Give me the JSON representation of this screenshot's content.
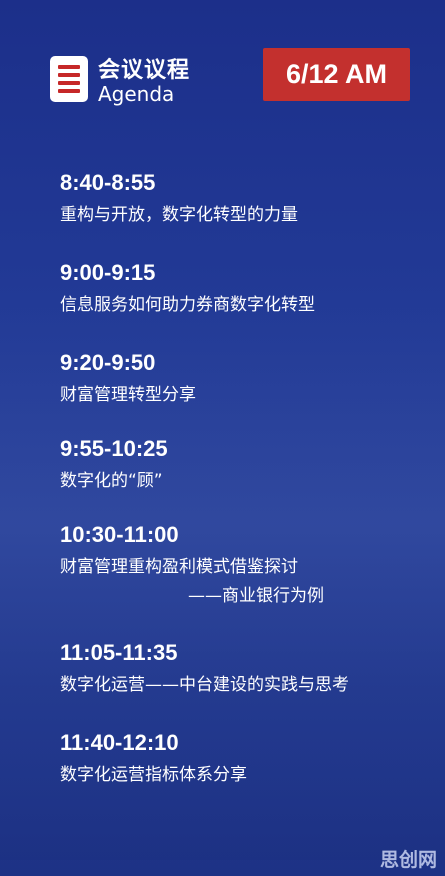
{
  "header": {
    "title_zh": "会议议程",
    "title_en": "Agenda",
    "time_badge": "6/12 AM"
  },
  "agenda": [
    {
      "time": "8:40-8:55",
      "topic": "重构与开放，数字化转型的力量",
      "sub": ""
    },
    {
      "time": "9:00-9:15",
      "topic": "信息服务如何助力券商数字化转型",
      "sub": ""
    },
    {
      "time": "9:20-9:50",
      "topic": "财富管理转型分享",
      "sub": ""
    },
    {
      "time": "9:55-10:25",
      "topic": "数字化的“顾”",
      "sub": ""
    },
    {
      "time": "10:30-11:00",
      "topic": "财富管理重构盈利模式借鉴探讨",
      "sub": "——商业银行为例"
    },
    {
      "time": "11:05-11:35",
      "topic": "数字化运营——中台建设的实践与思考",
      "sub": ""
    },
    {
      "time": "11:40-12:10",
      "topic": "数字化运营指标体系分享",
      "sub": ""
    }
  ],
  "watermark": "思创网",
  "colors": {
    "background": "#223a96",
    "badge": "#c3302e",
    "icon_bars": "#c62828"
  }
}
